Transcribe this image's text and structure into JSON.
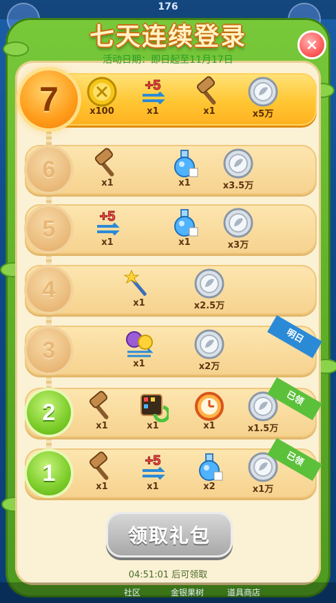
{
  "top_score": "176",
  "title": "七天连续登录",
  "date_text": "活动日期：即日起至11月17日",
  "close_label": "×",
  "claim_button": "领取礼包",
  "countdown": "04:51:01 后可领取",
  "bottom_labels": [
    "社区",
    "金银果树",
    "道具商店"
  ],
  "ribbon_labels": {
    "tomorrow": "明日",
    "claimed": "已领"
  },
  "days": [
    {
      "day": "7",
      "state": "today",
      "rewards": [
        {
          "icon": "gold-coin",
          "qty": "x100"
        },
        {
          "icon": "plus-five-moves",
          "qty": "x1"
        },
        {
          "icon": "hammer",
          "qty": "x1"
        },
        {
          "icon": "silver-coin",
          "qty": "x5万"
        }
      ]
    },
    {
      "day": "6",
      "state": "locked",
      "rewards": [
        {
          "icon": "hammer",
          "qty": "x1"
        },
        {
          "icon": "potion",
          "qty": "x1"
        },
        {
          "icon": "silver-coin",
          "qty": "x3.5万"
        }
      ]
    },
    {
      "day": "5",
      "state": "locked",
      "rewards": [
        {
          "icon": "plus-five-moves",
          "qty": "x1"
        },
        {
          "icon": "potion",
          "qty": "x1"
        },
        {
          "icon": "silver-coin",
          "qty": "x3万"
        }
      ]
    },
    {
      "day": "4",
      "state": "locked",
      "rewards": [
        {
          "icon": "magic-wand",
          "qty": "x1"
        },
        {
          "icon": "silver-coin",
          "qty": "x2.5万"
        }
      ]
    },
    {
      "day": "3",
      "state": "tomorrow",
      "rewards": [
        {
          "icon": "animal-bundle",
          "qty": "x1"
        },
        {
          "icon": "silver-coin",
          "qty": "x2万"
        }
      ]
    },
    {
      "day": "2",
      "state": "claimed",
      "rewards": [
        {
          "icon": "hammer",
          "qty": "x1"
        },
        {
          "icon": "refresh-board",
          "qty": "x1"
        },
        {
          "icon": "clock",
          "qty": "x1"
        },
        {
          "icon": "silver-coin",
          "qty": "x1.5万"
        }
      ]
    },
    {
      "day": "1",
      "state": "claimed",
      "rewards": [
        {
          "icon": "hammer",
          "qty": "x1"
        },
        {
          "icon": "plus-five-moves",
          "qty": "x1"
        },
        {
          "icon": "potion",
          "qty": "x2"
        },
        {
          "icon": "silver-coin",
          "qty": "x1万"
        }
      ]
    }
  ],
  "colors": {
    "today": "#ffb01f",
    "claimed": "#5cc13a",
    "tomorrow": "#2b8ad6",
    "panel": "#fbf1d5"
  }
}
